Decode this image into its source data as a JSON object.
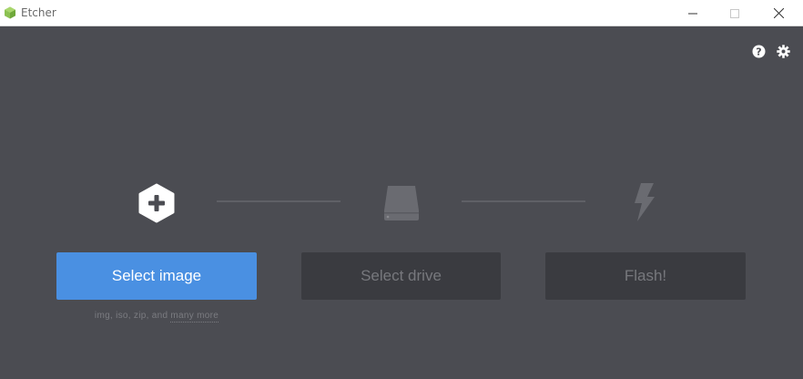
{
  "window": {
    "title": "Etcher",
    "logo_color": "#8cc152",
    "controls": [
      "minimize-icon",
      "maximize-icon",
      "close-icon"
    ]
  },
  "toolbar": {
    "help_icon": "question-circle-icon",
    "settings_icon": "gear-icon"
  },
  "steps": [
    {
      "icon": "plus-hexagon-icon",
      "button_label": "Select image",
      "state": "active"
    },
    {
      "icon": "drive-icon",
      "button_label": "Select drive",
      "state": "disabled"
    },
    {
      "icon": "lightning-bolt-icon",
      "button_label": "Flash!",
      "state": "disabled"
    }
  ],
  "image_hint": {
    "formats": "img, iso, zip, and",
    "more_link": "many more"
  },
  "colors": {
    "background": "#4b4c52",
    "primary": "#4a90e2",
    "disabled": "#3a3b40"
  }
}
